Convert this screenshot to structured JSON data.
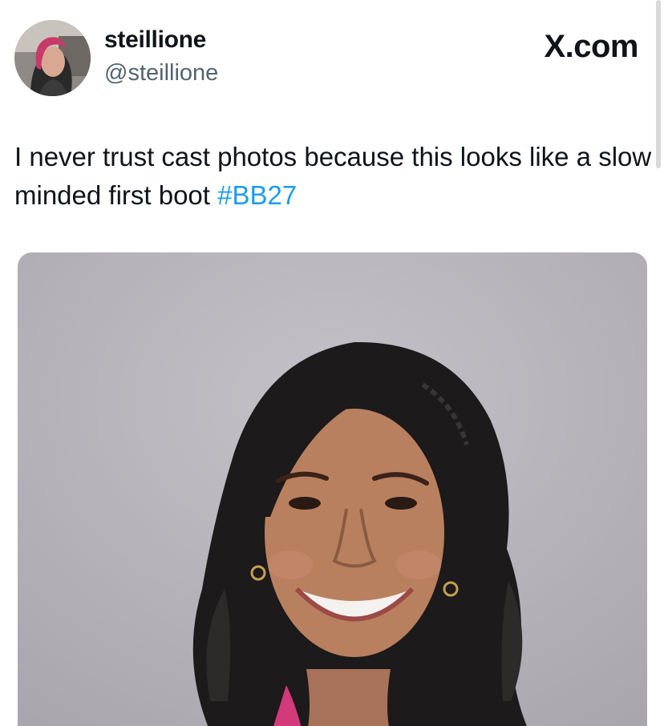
{
  "tweet": {
    "author": {
      "display_name": "steillione",
      "handle": "@steillione",
      "avatar_icon": "profile-photo"
    },
    "site_mark": "X.com",
    "text_before_hashtag": "I never trust cast photos because this looks like a slow minded first boot ",
    "hashtag": "#BB27",
    "media": {
      "type": "photo",
      "icon": "portrait-photo"
    }
  },
  "colors": {
    "text": "#0f1419",
    "secondary_text": "#536471",
    "link": "#1d9bf0",
    "photo_background": "#b7b5bb"
  }
}
